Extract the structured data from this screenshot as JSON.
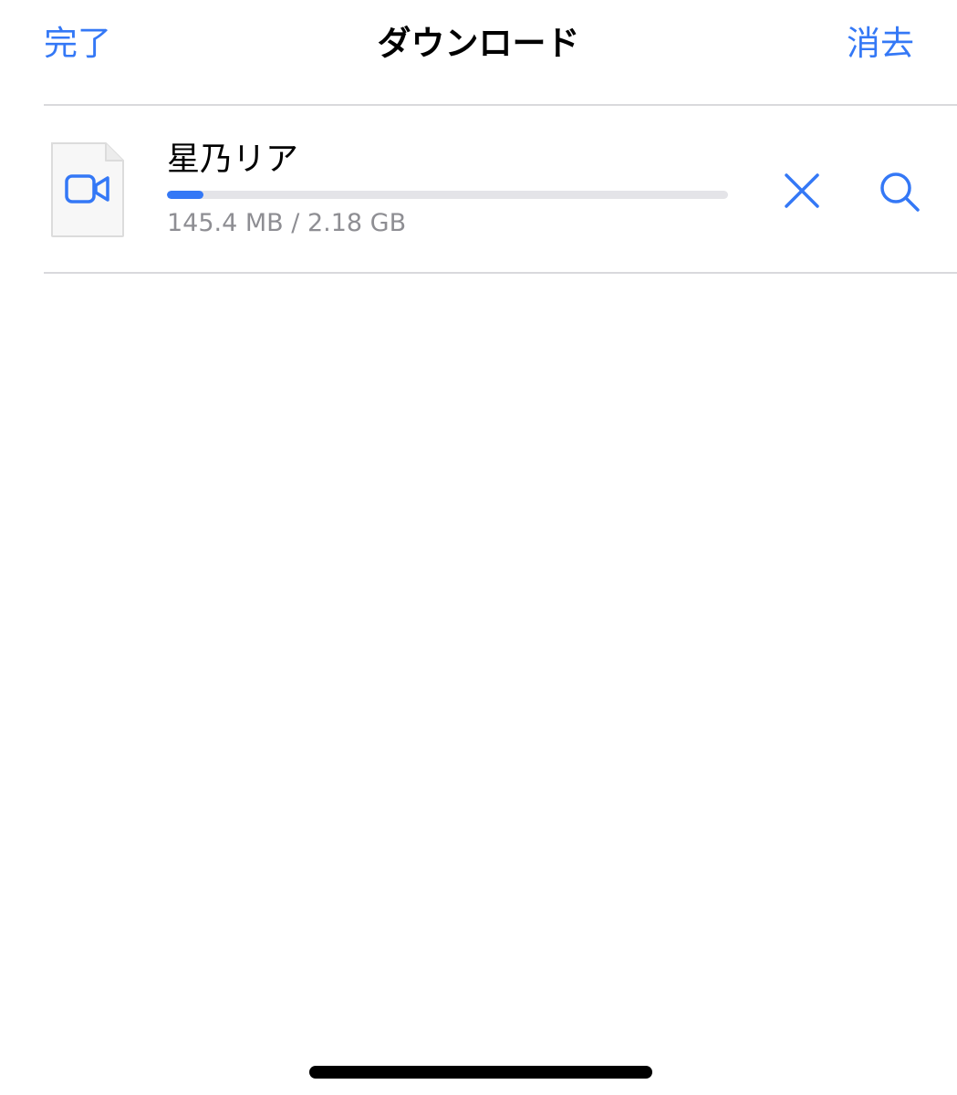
{
  "nav": {
    "done_label": "完了",
    "title": "ダウンロード",
    "clear_label": "消去"
  },
  "downloads": [
    {
      "name": "星乃リア",
      "size_text": "145.4 MB / 2.18 GB",
      "progress": 0.065,
      "file_icon": "video-file-icon"
    }
  ],
  "row_actions": {
    "cancel_icon": "close-icon",
    "search_icon": "search-icon"
  },
  "colors": {
    "accent": "#3478f6",
    "secondary_text": "#8e8e93",
    "track": "#e4e4e8"
  }
}
